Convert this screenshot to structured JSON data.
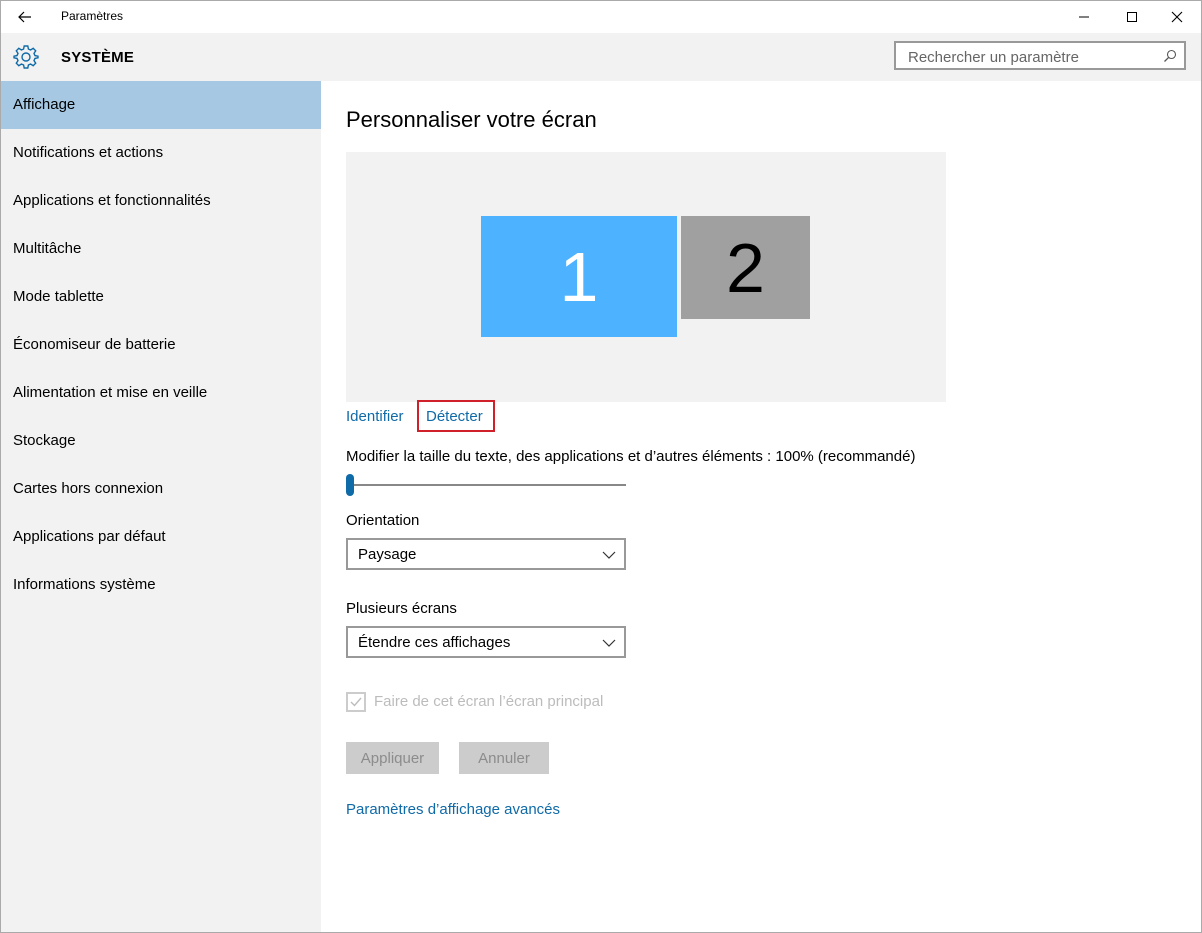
{
  "window": {
    "title": "Paramètres"
  },
  "header": {
    "section_title": "SYSTÈME",
    "search_placeholder": "Rechercher un paramètre"
  },
  "sidebar": {
    "items": [
      {
        "label": "Affichage",
        "selected": true
      },
      {
        "label": "Notifications et actions"
      },
      {
        "label": "Applications et fonctionnalités"
      },
      {
        "label": "Multitâche"
      },
      {
        "label": "Mode tablette"
      },
      {
        "label": "Économiseur de batterie"
      },
      {
        "label": "Alimentation et mise en veille"
      },
      {
        "label": "Stockage"
      },
      {
        "label": "Cartes hors connexion"
      },
      {
        "label": "Applications par défaut"
      },
      {
        "label": "Informations système"
      }
    ]
  },
  "main": {
    "title": "Personnaliser votre écran",
    "monitors": [
      "1",
      "2"
    ],
    "identify_label": "Identifier",
    "detect_label": "Détecter",
    "scale_label": "Modifier la taille du texte, des applications et d’autres éléments : 100% (recommandé)",
    "scale_slider_fraction": 0.0,
    "orientation_label": "Orientation",
    "orientation_value": "Paysage",
    "multi_label": "Plusieurs écrans",
    "multi_value": "Étendre ces affichages",
    "main_display_label": "Faire de cet écran l’écran principal",
    "main_display_checked": true,
    "apply_label": "Appliquer",
    "cancel_label": "Annuler",
    "advanced_link": "Paramètres d’affichage avancés"
  },
  "colors": {
    "accent": "#0f6aa8",
    "selected_nav": "#a6c8e3",
    "monitor_primary": "#4db2ff",
    "monitor_secondary": "#a0a0a0",
    "highlight_box": "#d0202a"
  }
}
